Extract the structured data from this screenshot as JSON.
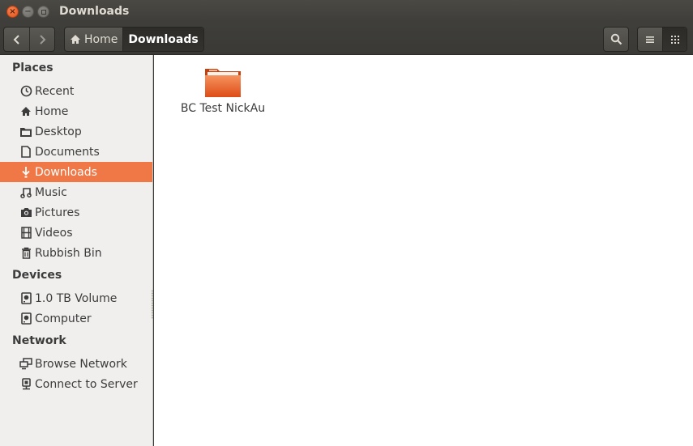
{
  "window": {
    "title": "Downloads",
    "close_glyph": "×",
    "minimize_glyph": "−"
  },
  "toolbar": {
    "back_glyph": "‹",
    "forward_glyph": "›",
    "path": {
      "home_label": "Home",
      "current_label": "Downloads"
    }
  },
  "sidebar": {
    "sections": [
      {
        "title": "Places",
        "items": [
          {
            "label": "Recent",
            "icon": "clock-icon"
          },
          {
            "label": "Home",
            "icon": "home-icon"
          },
          {
            "label": "Desktop",
            "icon": "desktop-folder-icon"
          },
          {
            "label": "Documents",
            "icon": "document-icon"
          },
          {
            "label": "Downloads",
            "icon": "download-icon",
            "active": true
          },
          {
            "label": "Music",
            "icon": "music-icon"
          },
          {
            "label": "Pictures",
            "icon": "camera-icon"
          },
          {
            "label": "Videos",
            "icon": "film-icon"
          },
          {
            "label": "Rubbish Bin",
            "icon": "trash-icon"
          }
        ]
      },
      {
        "title": "Devices",
        "items": [
          {
            "label": "1.0 TB Volume",
            "icon": "drive-icon"
          },
          {
            "label": "Computer",
            "icon": "drive-icon"
          }
        ]
      },
      {
        "title": "Network",
        "items": [
          {
            "label": "Browse Network",
            "icon": "network-icon"
          },
          {
            "label": "Connect to Server",
            "icon": "server-icon"
          }
        ]
      }
    ]
  },
  "content": {
    "files": [
      {
        "name": "BC Test NickAu",
        "type": "folder",
        "icon": "folder-icon"
      }
    ]
  },
  "colors": {
    "accent": "#f07746",
    "titlebar": "#3c3b37",
    "sidebar_bg": "#f0efed",
    "folder": "#e8602c"
  }
}
